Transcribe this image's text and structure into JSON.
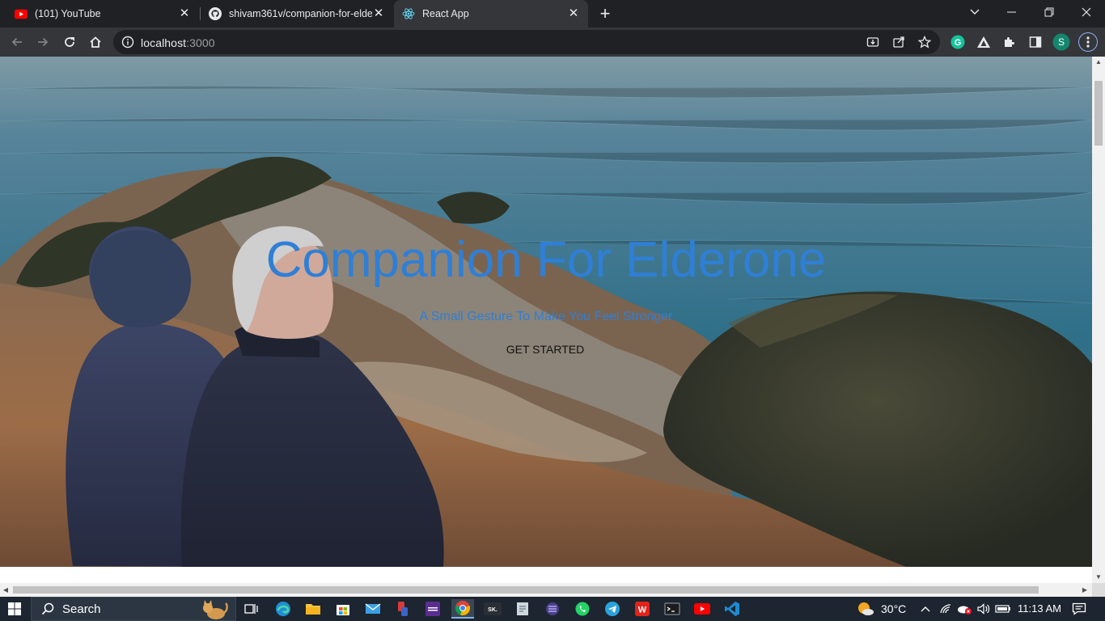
{
  "browser": {
    "tabs": [
      {
        "title": "(101) YouTube",
        "icon": "youtube-icon",
        "active": false
      },
      {
        "title": "shivam361v/companion-for-elde",
        "icon": "github-icon",
        "active": false
      },
      {
        "title": "React App",
        "icon": "react-icon",
        "active": true
      }
    ],
    "url_host": "localhost",
    "url_port": ":3000",
    "profile_initial": "S"
  },
  "page": {
    "title": "Companion For Elderone",
    "subtitle": "A Small Gesture To Make You Feel Stronger",
    "cta_label": "GET STARTED"
  },
  "taskbar": {
    "search_label": "Search",
    "weather": "30°C",
    "clock": "11:13 AM"
  },
  "colors": {
    "hero_text": "#2f7fd6",
    "browser_dark": "#202124",
    "toolbar": "#35363a",
    "taskbar": "#1c2530"
  }
}
